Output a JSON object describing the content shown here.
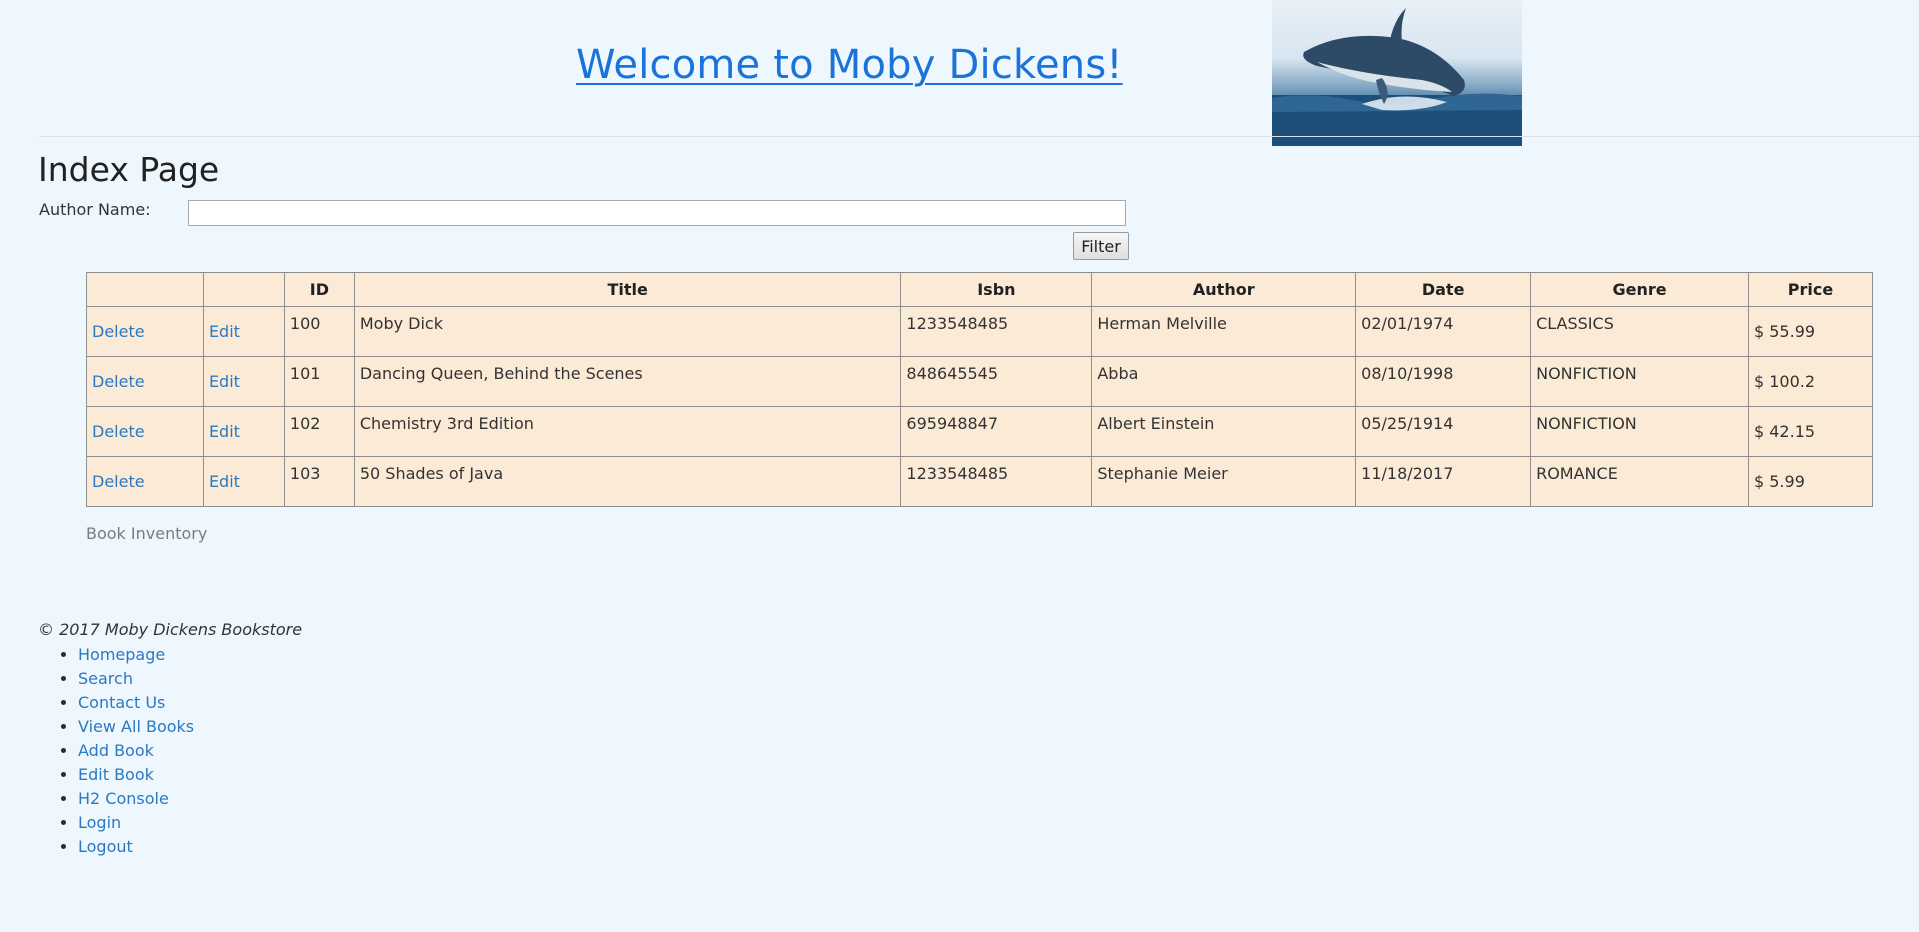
{
  "header": {
    "title": "Welcome to Moby Dickens!",
    "logo_icon": "whale-image"
  },
  "main": {
    "heading": "Index Page",
    "filter": {
      "label": "Author Name:",
      "value": "",
      "placeholder": "",
      "button_label": "Filter"
    },
    "table": {
      "columns": [
        "",
        "",
        "ID",
        "Title",
        "Isbn",
        "Author",
        "Date",
        "Genre",
        "Price"
      ],
      "rows": [
        {
          "delete": "Delete",
          "edit": "Edit",
          "id": "100",
          "title": "Moby Dick",
          "isbn": "1233548485",
          "author": "Herman Melville",
          "date": "02/01/1974",
          "genre": "CLASSICS",
          "price": "$ 55.99"
        },
        {
          "delete": "Delete",
          "edit": "Edit",
          "id": "101",
          "title": "Dancing Queen, Behind the Scenes",
          "isbn": "848645545",
          "author": "Abba",
          "date": "08/10/1998",
          "genre": "NONFICTION",
          "price": "$ 100.2"
        },
        {
          "delete": "Delete",
          "edit": "Edit",
          "id": "102",
          "title": "Chemistry 3rd Edition",
          "isbn": "695948847",
          "author": "Albert Einstein",
          "date": "05/25/1914",
          "genre": "NONFICTION",
          "price": "$ 42.15"
        },
        {
          "delete": "Delete",
          "edit": "Edit",
          "id": "103",
          "title": "50 Shades of Java",
          "isbn": "1233548485",
          "author": "Stephanie Meier",
          "date": "11/18/2017",
          "genre": "ROMANCE",
          "price": "$ 5.99"
        }
      ],
      "caption": "Book Inventory"
    }
  },
  "footer": {
    "copyright": "© 2017 Moby Dickens Bookstore",
    "links": [
      "Homepage",
      "Search",
      "Contact Us",
      "View All Books",
      "Add Book",
      "Edit Book",
      "H2 Console",
      "Login",
      "Logout"
    ]
  },
  "colors": {
    "background": "#eef7fd",
    "title_link": "#1a73d9",
    "link": "#2b79c2",
    "table_background": "#fbead6"
  }
}
